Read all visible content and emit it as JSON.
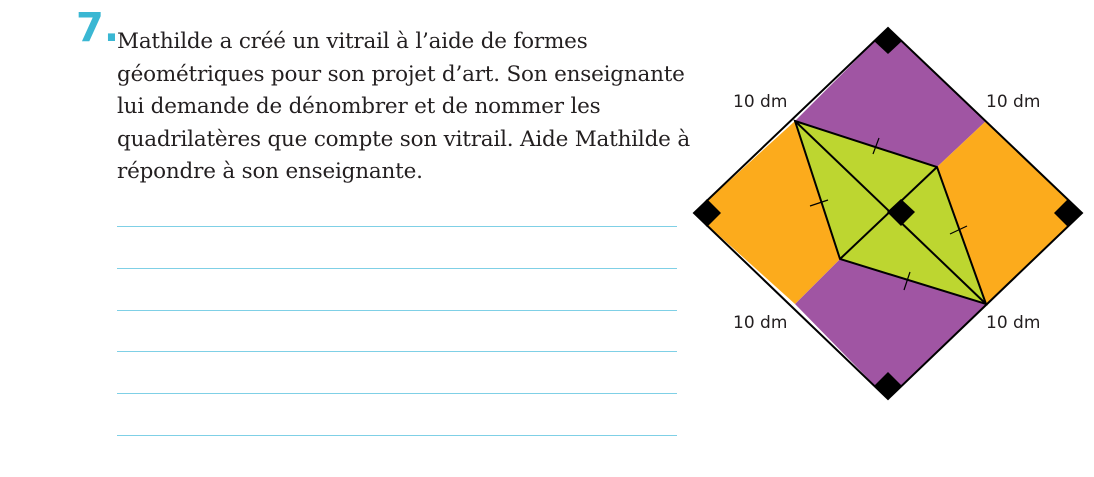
{
  "question": {
    "number": "7.",
    "text": "Mathilde a créé un vitrail à l’aide de formes géométriques pour son projet d’art. Son enseignante lui demande de dénombrer et de nommer les quadrilatères que compte son vitrail. Aide Mathilde à répondre à son enseignante."
  },
  "answer_lines": 6,
  "figure": {
    "labels": {
      "top_left": "10 dm",
      "top_right": "10 dm",
      "bottom_left": "10 dm",
      "bottom_right": "10 dm"
    },
    "colors": {
      "purple": "#a055a3",
      "orange": "#fcab1c",
      "green": "#bdd630",
      "outline": "#000000"
    }
  }
}
